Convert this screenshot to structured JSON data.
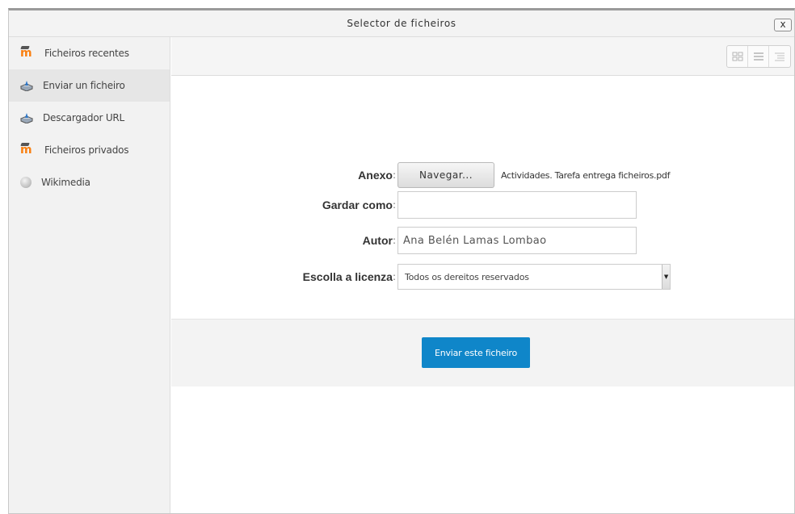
{
  "dialog": {
    "title": "Selector de ficheiros",
    "close_label": "x"
  },
  "sidebar": {
    "items": [
      {
        "label": "Ficheiros recentes",
        "icon": "moodle-icon",
        "active": false
      },
      {
        "label": "Enviar un ficheiro",
        "icon": "upload-icon",
        "active": true
      },
      {
        "label": "Descargador URL",
        "icon": "upload-icon",
        "active": false
      },
      {
        "label": "Ficheiros privados",
        "icon": "moodle-icon",
        "active": false
      },
      {
        "label": "Wikimedia",
        "icon": "globe-icon",
        "active": false
      }
    ]
  },
  "toolbar": {
    "views": [
      "grid-view-icon",
      "list-view-icon",
      "tree-view-icon"
    ]
  },
  "form": {
    "attachment": {
      "label": "Anexo",
      "button": "Navegar...",
      "file_name": "Actividades. Tarefa entrega ficheiros.pdf"
    },
    "save_as": {
      "label": "Gardar como",
      "value": ""
    },
    "author": {
      "label": "Autor",
      "value": "Ana Belén Lamas Lombao"
    },
    "license": {
      "label": "Escolla a licenza",
      "selected": "Todos os dereitos reservados"
    },
    "submit": "Enviar este ficheiro"
  },
  "colors": {
    "accent": "#0f86c9",
    "moodle_orange": "#f98012"
  }
}
